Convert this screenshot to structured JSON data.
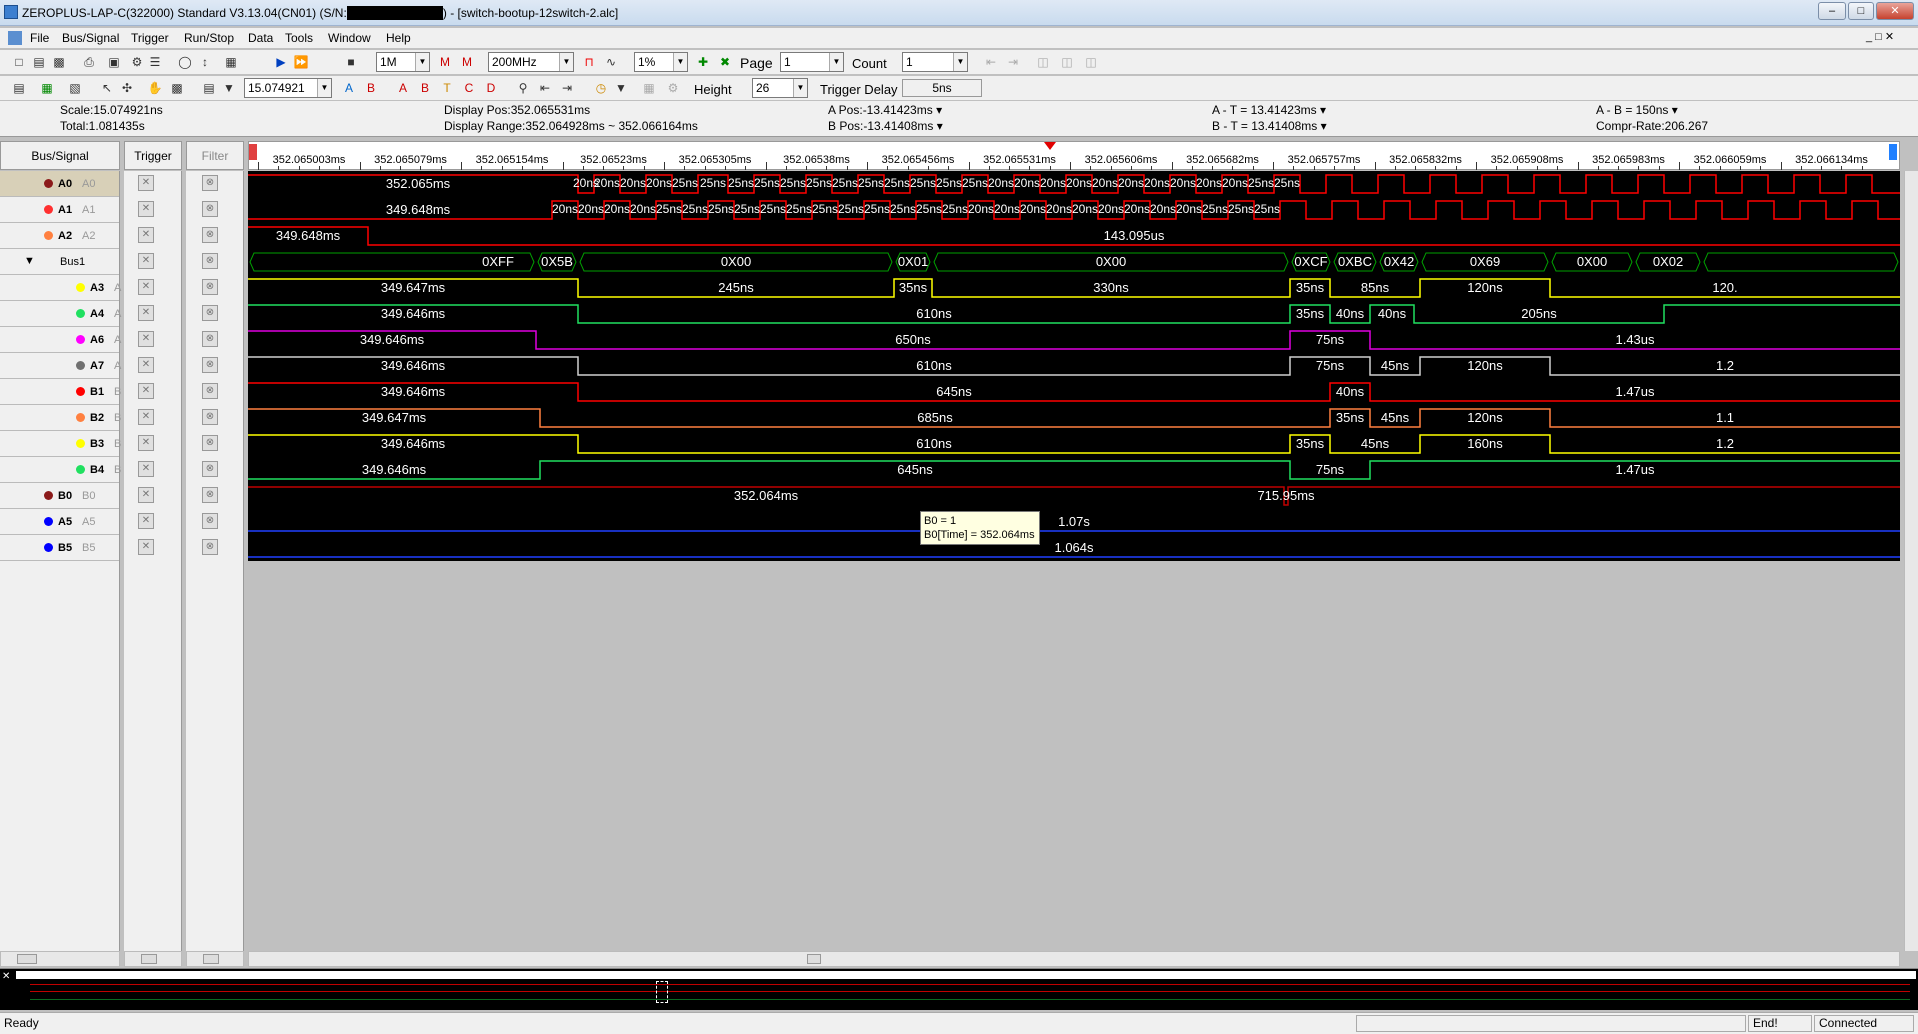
{
  "window": {
    "title": "ZEROPLUS-LAP-C(322000) Standard V3.13.04(CN01) (S/N:",
    "title_redacted": "XXXXXXXXXXXX",
    "title_tail": ") - [switch-bootup-12switch-2.alc]"
  },
  "menu": [
    "File",
    "Bus/Signal",
    "Trigger",
    "Run/Stop",
    "Data",
    "Tools",
    "Window",
    "Help"
  ],
  "toolbar1": {
    "sample_depth": "1M",
    "sample_rate": "200MHz",
    "trigger_pos": "1%",
    "page_label": "Page",
    "page_value": "1",
    "count_label": "Count",
    "count_value": "1"
  },
  "toolbar2": {
    "scale_value": "15.074921",
    "height_label": "Height",
    "height_value": "26",
    "trigger_delay_label": "Trigger Delay",
    "trigger_delay_value": "5ns"
  },
  "info": {
    "scale": "Scale:15.074921ns",
    "total": "Total:1.081435s",
    "display_pos": "Display Pos:352.065531ms",
    "display_range": "Display Range:352.064928ms ~ 352.066164ms",
    "a_pos": "A Pos:-13.41423ms",
    "b_pos": "B Pos:-13.41408ms",
    "a_t": "A - T = 13.41423ms",
    "b_t": "B - T = 13.41408ms",
    "a_b": "A - B = 150ns",
    "compr": "Compr-Rate:206.267"
  },
  "panels": {
    "bus_signal": "Bus/Signal",
    "trigger": "Trigger",
    "filter": "Filter"
  },
  "ticks": [
    "352.065003ms",
    "352.065079ms",
    "352.065154ms",
    "352.06523ms",
    "352.065305ms",
    "352.06538ms",
    "352.065456ms",
    "352.065531ms",
    "352.065606ms",
    "352.065682ms",
    "352.065757ms",
    "352.065832ms",
    "352.065908ms",
    "352.065983ms",
    "352.066059ms",
    "352.066134ms"
  ],
  "signals": [
    {
      "name": "A0",
      "alias": "A0",
      "color": "#8b1a1a",
      "wave": "#ff0000",
      "indent": false
    },
    {
      "name": "A1",
      "alias": "A1",
      "color": "#ff3030",
      "wave": "#ff0000",
      "indent": false
    },
    {
      "name": "A2",
      "alias": "A2",
      "color": "#ff8040",
      "wave": "#ff0000",
      "indent": false
    },
    {
      "name": "Bus1",
      "alias": "",
      "color": "",
      "wave": "#00a000",
      "indent": false
    },
    {
      "name": "A3",
      "alias": "A",
      "color": "#ffff00",
      "wave": "#ffff00",
      "indent": true
    },
    {
      "name": "A4",
      "alias": "A",
      "color": "#20e060",
      "wave": "#20e060",
      "indent": true
    },
    {
      "name": "A6",
      "alias": "A",
      "color": "#ff00ff",
      "wave": "#e000e0",
      "indent": true
    },
    {
      "name": "A7",
      "alias": "A",
      "color": "#707070",
      "wave": "#d0d0d0",
      "indent": true
    },
    {
      "name": "B1",
      "alias": "B",
      "color": "#ff0000",
      "wave": "#ff0000",
      "indent": true
    },
    {
      "name": "B2",
      "alias": "B",
      "color": "#ff8040",
      "wave": "#ff8040",
      "indent": true
    },
    {
      "name": "B3",
      "alias": "B",
      "color": "#ffff00",
      "wave": "#ffff00",
      "indent": true
    },
    {
      "name": "B4",
      "alias": "B",
      "color": "#20e060",
      "wave": "#20e060",
      "indent": true
    },
    {
      "name": "B0",
      "alias": "B0",
      "color": "#8b1a1a",
      "wave": "#c00000",
      "indent": false
    },
    {
      "name": "A5",
      "alias": "A5",
      "color": "#0000ff",
      "wave": "#2040ff",
      "indent": false
    },
    {
      "name": "B5",
      "alias": "B5",
      "color": "#0000ff",
      "wave": "#2040ff",
      "indent": false
    }
  ],
  "wave_labels": [
    [
      "352.065ms",
      "20ns",
      "20ns",
      "20ns",
      "20ns",
      "25ns",
      "25ns",
      "25ns",
      "25ns",
      "25ns",
      "25ns",
      "25ns",
      "25ns",
      "25ns",
      "25ns",
      "25ns",
      "25ns",
      "20ns",
      "20ns",
      "20ns",
      "20ns",
      "20ns",
      "20ns",
      "20ns",
      "20ns",
      "20ns",
      "20ns",
      "25ns",
      "25ns"
    ],
    [
      "349.648ms",
      "20ns",
      "20ns",
      "20ns",
      "20ns",
      "25ns",
      "25ns",
      "25ns",
      "25ns",
      "25ns",
      "25ns",
      "25ns",
      "25ns",
      "25ns",
      "25ns",
      "25ns",
      "25ns",
      "20ns",
      "20ns",
      "20ns",
      "20ns",
      "20ns",
      "20ns",
      "20ns",
      "20ns",
      "20ns",
      "25ns",
      "25ns",
      "25ns"
    ],
    [
      "349.648ms",
      "143.095us"
    ],
    [
      "0XFF",
      "0X5B",
      "0X00",
      "0X01",
      "0X00",
      "0XCF",
      "0XBC",
      "0X42",
      "0X69",
      "0X00",
      "0X02"
    ],
    [
      "349.647ms",
      "245ns",
      "35ns",
      "330ns",
      "35ns",
      "85ns",
      "120ns",
      "120."
    ],
    [
      "349.646ms",
      "610ns",
      "35ns",
      "40ns",
      "40ns",
      "205ns"
    ],
    [
      "349.646ms",
      "650ns",
      "75ns",
      "1.43us"
    ],
    [
      "349.646ms",
      "610ns",
      "75ns",
      "45ns",
      "120ns",
      "1.2"
    ],
    [
      "349.646ms",
      "645ns",
      "40ns",
      "1.47us"
    ],
    [
      "349.647ms",
      "685ns",
      "35ns",
      "45ns",
      "120ns",
      "1.1"
    ],
    [
      "349.646ms",
      "610ns",
      "35ns",
      "45ns",
      "160ns",
      "1.2"
    ],
    [
      "349.646ms",
      "645ns",
      "75ns",
      "1.47us"
    ],
    [
      "352.064ms",
      "715.95ms"
    ],
    [
      "1.07s"
    ],
    [
      "1.064s"
    ]
  ],
  "tooltip": {
    "line1": "B0 = 1",
    "line2": "B0[Time] = 352.064ms"
  },
  "status": {
    "ready": "Ready",
    "end": "End!",
    "connected": "Connected"
  }
}
